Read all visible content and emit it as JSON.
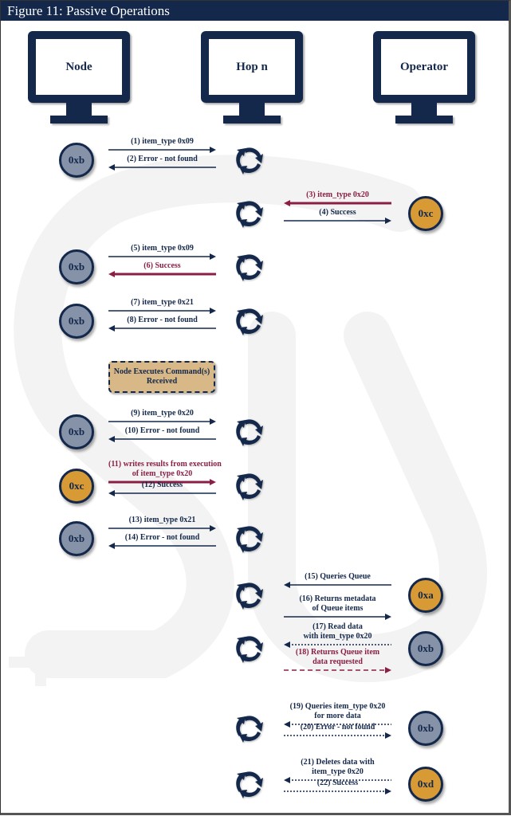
{
  "title": "Figure 11: Passive Operations",
  "participants": [
    {
      "id": "node",
      "label": "Node"
    },
    {
      "id": "hop",
      "label": "Hop n"
    },
    {
      "id": "operator",
      "label": "Operator"
    }
  ],
  "colors": {
    "navy": "#14284b",
    "crimson": "#8b1e45",
    "gray_node": "#8592a8",
    "orange_node": "#d89a35",
    "exec_box": "#d9b888"
  },
  "note": {
    "text_line1": "Node Executes Command(s)",
    "text_line2": "Received"
  },
  "rows": [
    {
      "side": "left",
      "node": "0xb",
      "node_color": "gray",
      "messages": [
        {
          "label": "(1) item_type 0x09",
          "dir": "right",
          "color": "blue",
          "style": "solid"
        },
        {
          "label": "(2) Error - not found",
          "dir": "left",
          "color": "blue",
          "style": "solid"
        }
      ]
    },
    {
      "side": "right",
      "node": "0xc",
      "node_color": "orange",
      "messages": [
        {
          "label": "(3) item_type 0x20",
          "dir": "left",
          "color": "red",
          "style": "solid"
        },
        {
          "label": "(4) Success",
          "dir": "right",
          "color": "blue",
          "style": "solid"
        }
      ]
    },
    {
      "side": "left",
      "node": "0xb",
      "node_color": "gray",
      "messages": [
        {
          "label": "(5) item_type 0x09",
          "dir": "right",
          "color": "blue",
          "style": "solid"
        },
        {
          "label": "(6) Success",
          "dir": "left",
          "color": "red",
          "style": "solid"
        }
      ]
    },
    {
      "side": "left",
      "node": "0xb",
      "node_color": "gray",
      "messages": [
        {
          "label": "(7) item_type 0x21",
          "dir": "right",
          "color": "blue",
          "style": "solid"
        },
        {
          "label": "(8) Error - not found",
          "dir": "left",
          "color": "blue",
          "style": "solid"
        }
      ]
    },
    {
      "side": "left",
      "node": "0xb",
      "node_color": "gray",
      "messages": [
        {
          "label": "(9) item_type 0x20",
          "dir": "right",
          "color": "blue",
          "style": "solid"
        },
        {
          "label": "(10) Error - not found",
          "dir": "left",
          "color": "blue",
          "style": "solid"
        }
      ]
    },
    {
      "side": "left",
      "node": "0xc",
      "node_color": "orange",
      "messages": [
        {
          "label": "(11) writes results from execution",
          "label2": "of item_type 0x20",
          "dir": "right",
          "color": "red",
          "style": "solid"
        },
        {
          "label": "(12) Success",
          "dir": "left",
          "color": "blue",
          "style": "solid"
        }
      ]
    },
    {
      "side": "left",
      "node": "0xb",
      "node_color": "gray",
      "messages": [
        {
          "label": "(13) item_type 0x21",
          "dir": "right",
          "color": "blue",
          "style": "solid"
        },
        {
          "label": "(14) Error - not found",
          "dir": "left",
          "color": "blue",
          "style": "solid"
        }
      ]
    },
    {
      "side": "right",
      "node": "0xa",
      "node_color": "orange",
      "messages": [
        {
          "label": "(15) Queries Queue",
          "dir": "left",
          "color": "blue",
          "style": "solid"
        },
        {
          "label": "(16) Returns metadata",
          "label2": "of Queue items",
          "dir": "right",
          "color": "blue",
          "style": "solid"
        }
      ]
    },
    {
      "side": "right",
      "node": "0xb",
      "node_color": "gray",
      "messages": [
        {
          "label": "(17) Read data",
          "label2": "with item_type 0x20",
          "dir": "left",
          "color": "blue",
          "style": "dotted"
        },
        {
          "label": "(18) Returns Queue item",
          "label2": "data requested",
          "dir": "right",
          "color": "red",
          "style": "dashed"
        }
      ]
    },
    {
      "side": "right",
      "node": "0xb",
      "node_color": "gray",
      "messages": [
        {
          "label": "(19) Queries item_type 0x20",
          "label2": "for more data",
          "dir": "left",
          "color": "blue",
          "style": "dotted"
        },
        {
          "label": "(20) Error - not found",
          "dir": "right",
          "color": "blue",
          "style": "dotted"
        }
      ]
    },
    {
      "side": "right",
      "node": "0xd",
      "node_color": "orange",
      "messages": [
        {
          "label": "(21) Deletes data with",
          "label2": "item_type 0x20",
          "dir": "left",
          "color": "blue",
          "style": "dotted"
        },
        {
          "label": "(22) Success",
          "dir": "right",
          "color": "blue",
          "style": "dotted"
        }
      ]
    }
  ]
}
